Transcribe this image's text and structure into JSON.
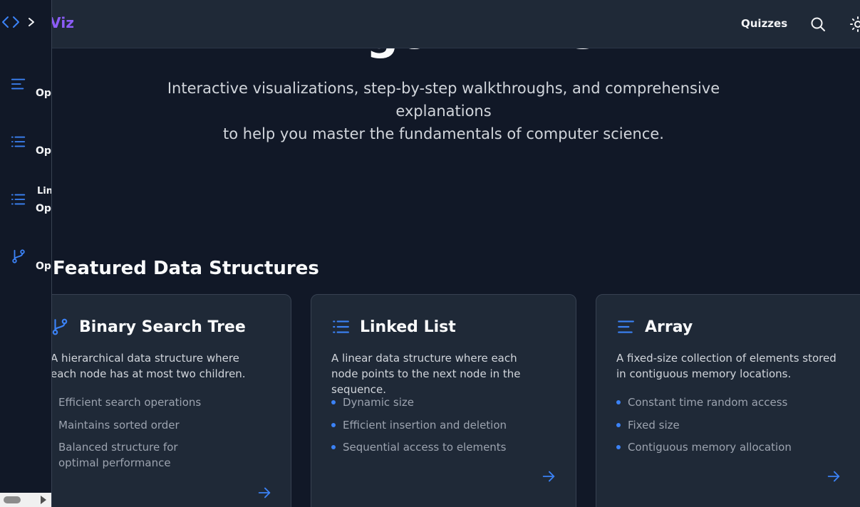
{
  "header": {
    "brand": "Viz",
    "nav_quizzes": "Quizzes",
    "icons": [
      "search-icon",
      "sun-icon"
    ]
  },
  "hero": {
    "title": "Algorithms",
    "subtitle_line1": "Interactive visualizations, step-by-step walkthroughs, and comprehensive explanations",
    "subtitle_line2": "to help you master the fundamentals of computer science."
  },
  "sidebar": {
    "icons": [
      "code-icon",
      "chevron-right-icon"
    ],
    "items": [
      {
        "icon": "align-left-icon",
        "label": "Op"
      },
      {
        "icon": "list-icon",
        "label": "Op"
      },
      {
        "icon": "list-icon",
        "label_top": "Lin",
        "label": "Op"
      },
      {
        "icon": "git-branch-icon",
        "label": "Op"
      }
    ]
  },
  "featured": {
    "title": "Featured Data Structures",
    "cards": [
      {
        "icon": "git-branch-icon",
        "title": "Binary Search Tree",
        "description": "A hierarchical data structure where each node has at most two children.",
        "features": [
          "Efficient search operations",
          "Maintains sorted order",
          "Balanced structure for optimal performance"
        ]
      },
      {
        "icon": "list-icon",
        "title": "Linked List",
        "description": "A linear data structure where each node points to the next node in the sequence.",
        "features": [
          "Dynamic size",
          "Efficient insertion and deletion",
          "Sequential access to elements"
        ]
      },
      {
        "icon": "align-left-icon",
        "title": "Array",
        "description": "A fixed-size collection of elements stored in contiguous memory locations.",
        "features": [
          "Constant time random access",
          "Fixed size",
          "Contiguous memory allocation"
        ]
      }
    ]
  },
  "colors": {
    "background": "#111827",
    "surface": "#1f2937",
    "accent": "#3b82f6",
    "brand": "#8b5cf6"
  }
}
